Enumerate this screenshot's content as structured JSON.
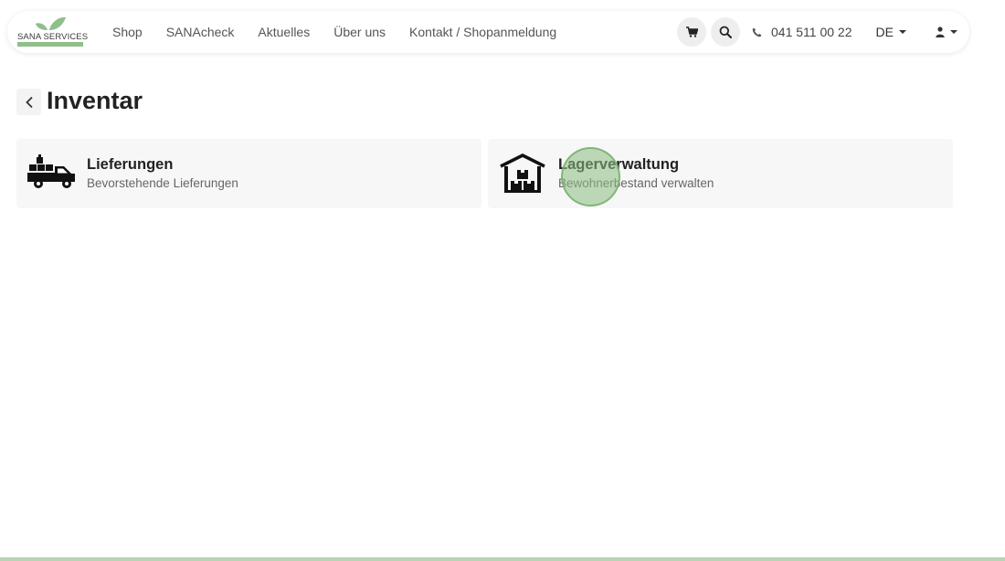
{
  "brand": {
    "logo_text": "SANA SERVICES",
    "accent_color": "#8fbf8a"
  },
  "nav": {
    "links": [
      "Shop",
      "SANAcheck",
      "Aktuelles",
      "Über uns",
      "Kontakt / Shopanmeldung"
    ],
    "cart_icon": "cart-icon",
    "search_icon": "search-icon",
    "phone": "041 511 00 22",
    "language": "DE"
  },
  "page": {
    "title": "Inventar"
  },
  "cards": [
    {
      "title": "Lieferungen",
      "subtitle": "Bevorstehende Lieferungen",
      "icon": "delivery-truck-icon"
    },
    {
      "title": "Lagerverwaltung",
      "subtitle": "Bewohnerbestand verwalten",
      "icon": "warehouse-icon"
    }
  ]
}
